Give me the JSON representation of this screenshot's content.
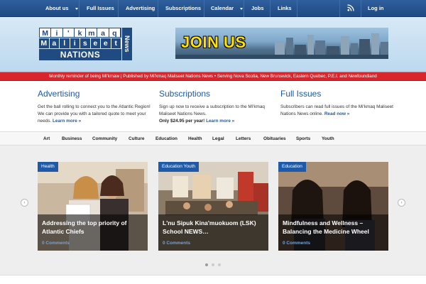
{
  "nav": {
    "items": [
      {
        "label": "About us",
        "has_dropdown": true
      },
      {
        "label": "Full Issues",
        "has_dropdown": false
      },
      {
        "label": "Advertising",
        "has_dropdown": false
      },
      {
        "label": "Subscriptions",
        "has_dropdown": false
      },
      {
        "label": "Calendar",
        "has_dropdown": true
      },
      {
        "label": "Jobs",
        "has_dropdown": false
      },
      {
        "label": "Links",
        "has_dropdown": false
      }
    ],
    "rss_icon": "rss-icon",
    "login_label": "Log in"
  },
  "header": {
    "logo": {
      "row1": [
        "M",
        "i",
        "'",
        "k",
        "m",
        "a",
        "q"
      ],
      "row2": [
        "M",
        "a",
        "l",
        "i",
        "s",
        "e",
        "e",
        "t"
      ],
      "row3": "NATIONS",
      "side": "News"
    },
    "banner_text": "JOIN US"
  },
  "tagline": "Monthly reminder of being Mi'kmaw | Published by Mi'kmaq Maliseet Nations News • Serving Nova Scotia, New Brunswick, Eastern Quebec, P.E.I. and Newfoundland",
  "columns": {
    "advertising": {
      "title": "Advertising",
      "text": "Get the ball rolling to connect you to the Atlantic Region! We can provide you with a tailored quote to meet your needs.",
      "link": "Learn more »"
    },
    "subscriptions": {
      "title": "Subscriptions",
      "text": "Sign up now to receive a subscription to the Mi'kmaq Maliseet Nations News.",
      "price": "Only $24.95 per year!",
      "link": "Learn more »"
    },
    "full_issues": {
      "title": "Full Issues",
      "text": "Subscribers can read full issues of the Mi'kmaq Maliseet Nations News online.",
      "link": "Read now »"
    }
  },
  "categories": [
    "Art",
    "Business",
    "Community",
    "Culture",
    "Education",
    "Health",
    "Legal",
    "Letters",
    "Obituaries",
    "Sports",
    "Youth"
  ],
  "slider": {
    "cards": [
      {
        "tag": "Health",
        "title": "Addressing the top priority of Atlantic Chiefs",
        "comments": "0 Comments"
      },
      {
        "tag": "Education  Youth",
        "title": "L'nu Sipuk Kina'muokuom (LSK) School NEWS…",
        "comments": "0 Comments"
      },
      {
        "tag": "Education",
        "title": "Mindfulness and Wellness – Balancing the Medicine Wheel",
        "comments": "0 Comments"
      }
    ],
    "prev_icon": "chevron-left-icon",
    "next_icon": "chevron-right-icon",
    "prev_glyph": "‹",
    "next_glyph": "›",
    "pages": 3,
    "active_page": 1
  },
  "colors": {
    "nav_blue": "#1f4a82",
    "accent_red": "#d9262d",
    "link_blue": "#1f5aa8",
    "banner_yellow": "#ffe000"
  }
}
